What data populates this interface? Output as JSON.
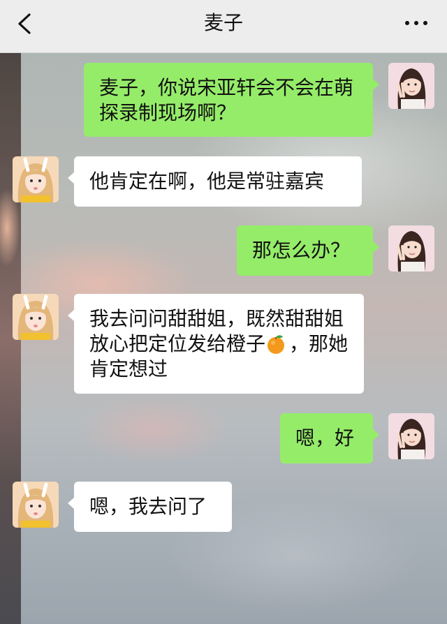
{
  "header": {
    "title": "麦子",
    "back_icon": "chevron-left-icon",
    "more_icon": "more-dots-icon"
  },
  "colors": {
    "header_bg": "#ededed",
    "my_bubble": "#95ec69",
    "their_bubble": "#ffffff"
  },
  "messages": [
    {
      "sender": "me",
      "text": "麦子，你说宋亚轩会不会在萌探录制现场啊？"
    },
    {
      "sender": "other",
      "text": "他肯定在啊，他是常驻嘉宾"
    },
    {
      "sender": "me",
      "text": "那怎么办？"
    },
    {
      "sender": "other",
      "text_before_emoji": "我去问问甜甜姐，既然甜甜姐放心把定位发给橙子",
      "emoji": "tangerine",
      "text_after_emoji": "，那她肯定想过"
    },
    {
      "sender": "me",
      "text": "嗯，好"
    },
    {
      "sender": "other",
      "text": "嗯，我去问了"
    }
  ]
}
